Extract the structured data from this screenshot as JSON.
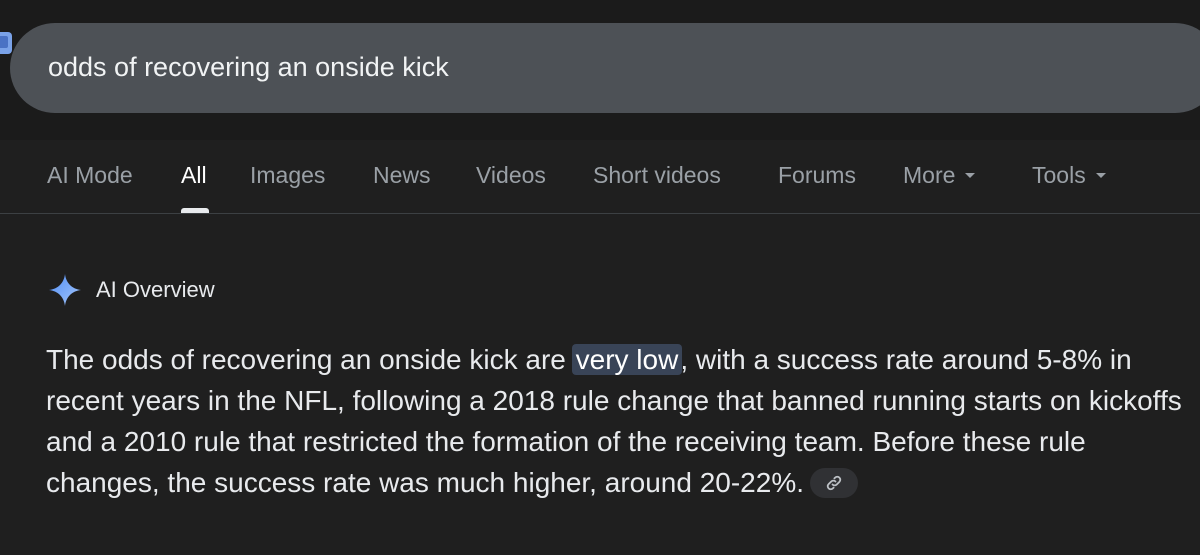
{
  "search": {
    "query": "odds of recovering an onside kick"
  },
  "tabs": [
    {
      "label": "AI Mode",
      "active": false
    },
    {
      "label": "All",
      "active": true
    },
    {
      "label": "Images",
      "active": false
    },
    {
      "label": "News",
      "active": false
    },
    {
      "label": "Videos",
      "active": false
    },
    {
      "label": "Short videos",
      "active": false
    },
    {
      "label": "Forums",
      "active": false
    },
    {
      "label": "More",
      "active": false,
      "dropdown": true
    },
    {
      "label": "Tools",
      "active": false,
      "dropdown": true
    }
  ],
  "ai_overview": {
    "title": "AI Overview",
    "icon": "sparkle-icon",
    "text_before": "The odds of recovering an onside kick are ",
    "highlight": "very low",
    "text_after": ", with a success rate around 5-8% in recent years in the NFL, following a 2018 rule change that banned running starts on kickoffs and a 2010 rule that restricted the formation of the receiving team. Before these rule changes, the success rate was much higher, around 20-22%.",
    "link_icon": "link-icon"
  },
  "colors": {
    "background": "#1f1f1f",
    "search_bar": "#4d5156",
    "tab_inactive": "#9aa0a6",
    "tab_active": "#ffffff",
    "highlight_bg": "#394457",
    "sparkle": "#8ab4f8"
  }
}
